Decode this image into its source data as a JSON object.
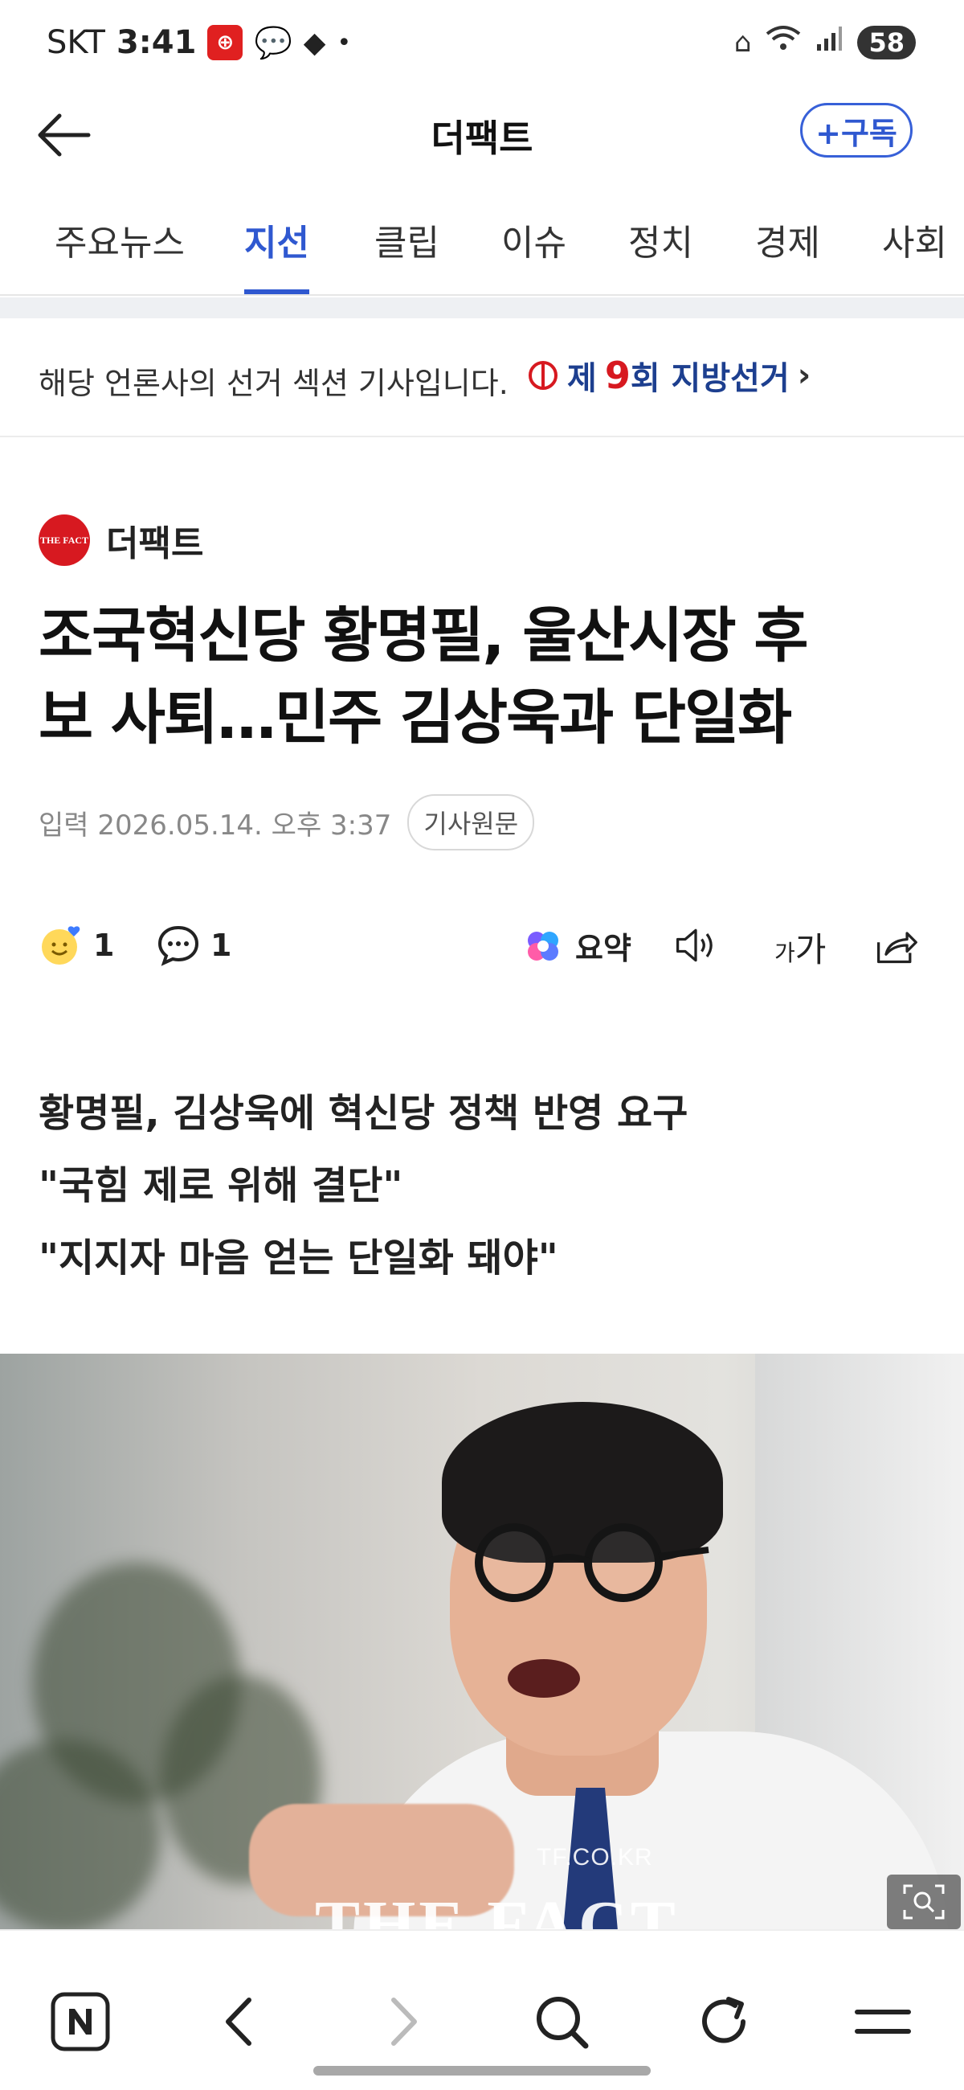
{
  "status_bar": {
    "carrier": "SKT",
    "time": "3:41",
    "battery": "58"
  },
  "header": {
    "back_icon": "arrow-left-icon",
    "title": "더팩트",
    "subscribe_label": "+구독"
  },
  "tabs": [
    {
      "label": "주요뉴스",
      "active": false
    },
    {
      "label": "지선",
      "active": true
    },
    {
      "label": "클립",
      "active": false
    },
    {
      "label": "이슈",
      "active": false
    },
    {
      "label": "정치",
      "active": false
    },
    {
      "label": "경제",
      "active": false
    },
    {
      "label": "사회",
      "active": false
    }
  ],
  "election_banner": {
    "text": "해당 언론사의 선거 섹션 기사입니다.",
    "link_prefix": "제",
    "link_number": "9",
    "link_suffix": "회 지방선거",
    "chevron": "›"
  },
  "article": {
    "press_logo_text": "THE FACT",
    "press_name": "더팩트",
    "headline_line1": "조국혁신당 황명필, 울산시장 후",
    "headline_line2": "보 사퇴…민주 김상욱과 단일화",
    "meta_label": "입력",
    "meta_datetime": "2026.05.14. 오후 3:37",
    "original_label": "기사원문",
    "reaction_count": "1",
    "comment_count": "1",
    "summary_label": "요약",
    "font_size_label_small": "가",
    "font_size_label_large": "가",
    "summary_lines": [
      "황명필, 김상욱에 혁신당 정책 반영 요구",
      "\"국힘 제로 위해 결단\"",
      "\"지지자 마음 얻는 단일화 돼야\""
    ],
    "photo_watermark_small": "TF.CO.KR",
    "photo_watermark_big": "THE FACT"
  },
  "colors": {
    "accent": "#2f58d0",
    "press_red": "#d71920",
    "election_navy": "#1d3f8f"
  }
}
